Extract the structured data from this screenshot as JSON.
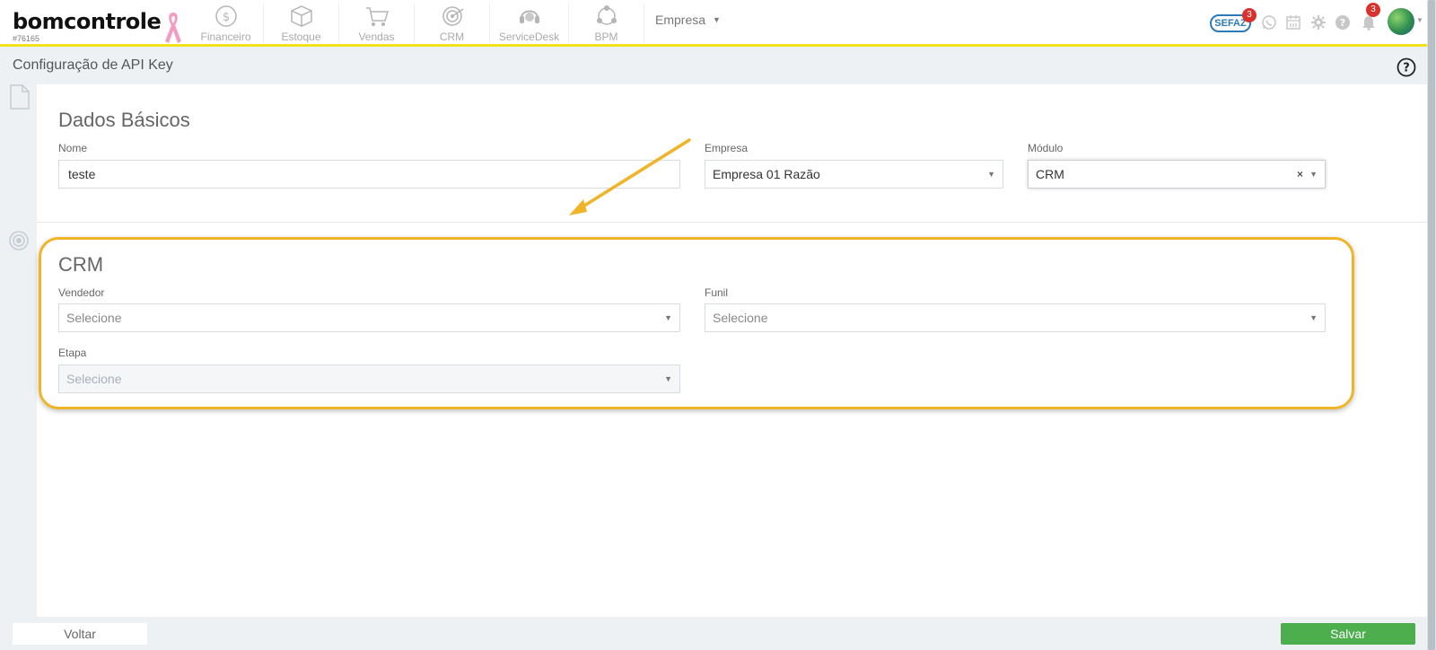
{
  "app": {
    "logo_text": "bomcontrole",
    "account_id": "#76165"
  },
  "nav": {
    "items": [
      {
        "label": "Financeiro",
        "icon": "dollar-coin-icon"
      },
      {
        "label": "Estoque",
        "icon": "box-icon"
      },
      {
        "label": "Vendas",
        "icon": "shopping-cart-icon"
      },
      {
        "label": "CRM",
        "icon": "target-icon"
      },
      {
        "label": "ServiceDesk",
        "icon": "headset-icon"
      },
      {
        "label": "BPM",
        "icon": "process-cycle-icon"
      }
    ],
    "empresa_label": "Empresa"
  },
  "header_right": {
    "sefaz_label": "SEFAZ",
    "sefaz_count": "3",
    "notification_count": "3"
  },
  "page": {
    "title": "Configuração de API Key"
  },
  "dados_basicos": {
    "title": "Dados Básicos",
    "nome_label": "Nome",
    "nome_value": "teste",
    "empresa_label": "Empresa",
    "empresa_value": "Empresa 01 Razão",
    "modulo_label": "Módulo",
    "modulo_value": "CRM"
  },
  "crm": {
    "title": "CRM",
    "vendedor_label": "Vendedor",
    "vendedor_value": "Selecione",
    "funil_label": "Funil",
    "funil_value": "Selecione",
    "etapa_label": "Etapa",
    "etapa_value": "Selecione"
  },
  "footer": {
    "back_label": "Voltar",
    "save_label": "Salvar"
  },
  "colors": {
    "accent_yellow": "#f2e21e",
    "highlight_orange": "#f0b429",
    "save_green": "#4cae4c",
    "badge_red": "#d9322e"
  }
}
